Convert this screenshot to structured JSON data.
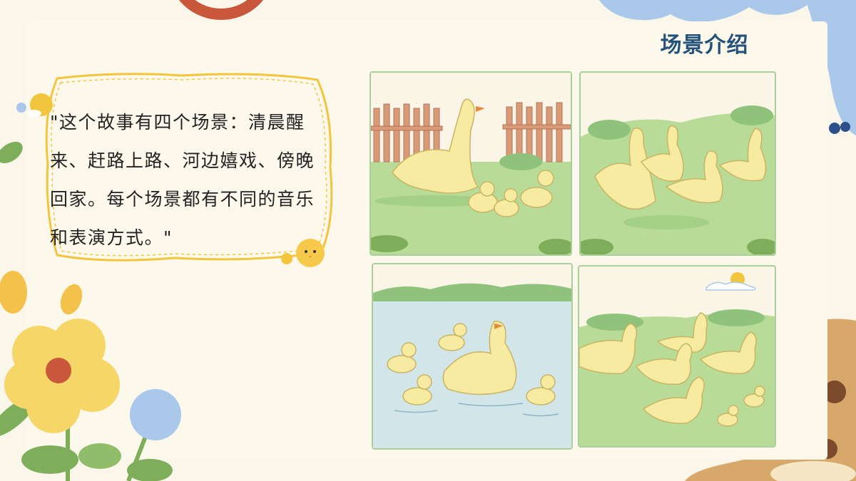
{
  "slide": {
    "title": "场景介绍",
    "quote": "\"这个故事有四个场景：清晨醒来、赶路上路、河边嬉戏、傍晚回家。每个场景都有不同的音乐和表演方式。\""
  },
  "panels": [
    {
      "scene": "morning-wake-up"
    },
    {
      "scene": "on-the-road"
    },
    {
      "scene": "playing-by-river"
    },
    {
      "scene": "going-home-evening"
    }
  ],
  "colors": {
    "background": "#fbf6ea",
    "title": "#24527a",
    "bubble_border": "#f2c53d",
    "panel_border": "#a9cf9a",
    "grass": "#b8dc98",
    "duck": "#f6eba0"
  }
}
